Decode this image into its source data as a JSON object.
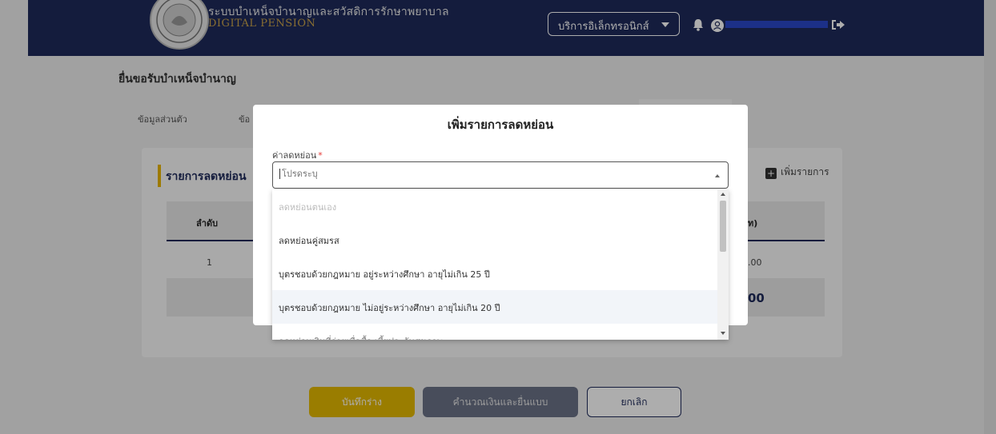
{
  "header": {
    "brand_th": "ระบบบำเหน็จบำนาญและสวัสดิการรักษาพยาบาล",
    "brand_en": "DIGITAL PENSION",
    "service_select": "บริการอิเล็กทรอนิกส์",
    "icons": [
      "logo-seal",
      "bell-icon",
      "user-icon",
      "logout-icon"
    ]
  },
  "page": {
    "title": "ยื่นขอรับบำเหน็จบำนาญ",
    "tabs": [
      "ข้อมูลส่วนตัว",
      "ข้อ"
    ]
  },
  "section": {
    "title": "รายการลดหย่อน",
    "add_label": "เพิ่มรายการ"
  },
  "table": {
    "headers": [
      "ลำดับ",
      "ท)"
    ],
    "rows": [
      {
        "index": "1",
        "amount": ".00"
      }
    ],
    "total": "00"
  },
  "buttons": {
    "save": "บันทึกร่าง",
    "calc": "คำนวณเงินและยื่นแบบ",
    "cancel": "ยกเลิก"
  },
  "modal": {
    "title": "เพิ่มรายการลดหย่อน",
    "field_label": "ค่าลดหย่อน",
    "required_mark": "*",
    "placeholder": "โปรดระบุ",
    "options": [
      "ลดหย่อนตนเอง",
      "ลดหย่อนคู่สมรส",
      "บุตรชอบด้วยกฎหมาย อยู่ระหว่างศึกษา อายุไม่เกิน 25 ปี",
      "บุตรชอบด้วยกฎหมาย ไม่อยู่ระหว่างศึกษา อายุไม่เกิน 20 ปี",
      "ลดหย่อนเงินที่จ่ายเพื่อซื้อ เบี้ยประกันสุขภาพ"
    ]
  },
  "colors": {
    "header_bg": "#1e2a5a",
    "accent_yellow": "#e4b800",
    "calc_button": "#6b7287",
    "required": "#e53935"
  }
}
